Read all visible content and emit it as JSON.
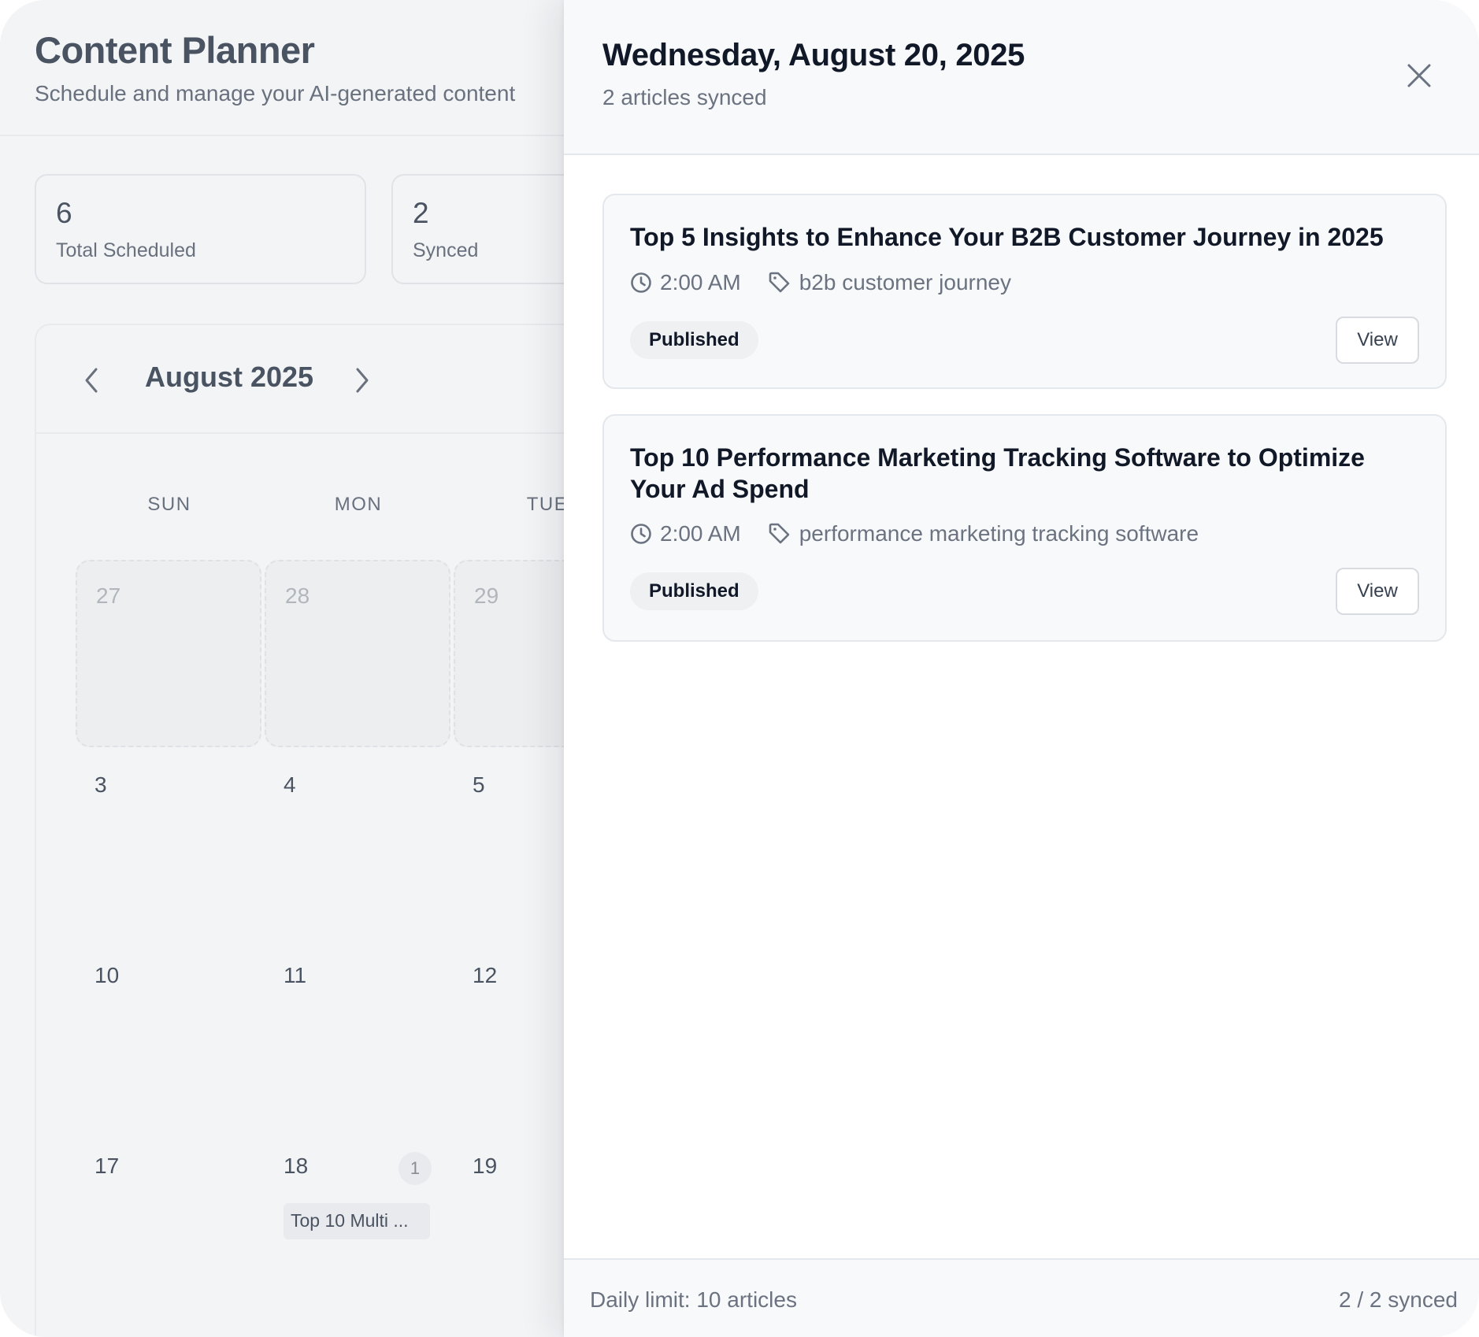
{
  "page": {
    "title": "Content Planner",
    "subtitle": "Schedule and manage your AI-generated content"
  },
  "stats": [
    {
      "value": "6",
      "label": "Total Scheduled"
    },
    {
      "value": "2",
      "label": "Synced"
    }
  ],
  "calendar": {
    "month": "August 2025",
    "weekdays": [
      "SUN",
      "MON",
      "TUE"
    ],
    "days": {
      "r0": [
        "27",
        "28",
        "29"
      ],
      "r1": [
        "3",
        "4",
        "5"
      ],
      "r2": [
        "10",
        "11",
        "12"
      ],
      "r3": [
        "17",
        "18",
        "19"
      ]
    },
    "day18_count": "1",
    "day18_event": "Top 10 Multi ..."
  },
  "drawer": {
    "title": "Wednesday, August 20, 2025",
    "subtitle": "2 articles synced",
    "articles": [
      {
        "title": "Top 5 Insights to Enhance Your B2B Customer Journey in 2025",
        "time": "2:00 AM",
        "keyword": "b2b customer journey",
        "status": "Published",
        "action": "View"
      },
      {
        "title": "Top 10 Performance Marketing Tracking Software to Optimize Your Ad Spend",
        "time": "2:00 AM",
        "keyword": "performance marketing tracking software",
        "status": "Published",
        "action": "View"
      }
    ],
    "footer": {
      "limit": "Daily limit: 10 articles",
      "synced": "2 / 2 synced"
    }
  },
  "icons": {
    "prev": "chevron-left-icon",
    "next": "chevron-right-icon",
    "close": "close-icon",
    "time": "clock-icon",
    "keyword": "tag-icon"
  },
  "colors": {
    "background": "#f7f8fa",
    "drawer": "#ffffff",
    "title": "#111827",
    "muted": "#6b7280",
    "border": "#e4e7eb"
  }
}
